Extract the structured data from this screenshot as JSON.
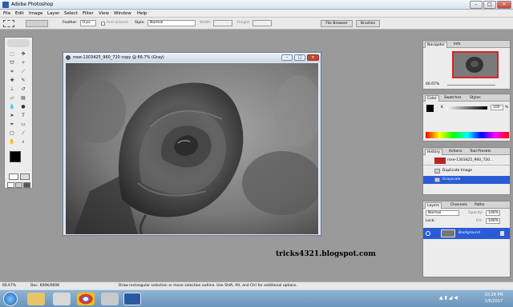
{
  "window": {
    "title": "Adobe Photoshop"
  },
  "menu": [
    "File",
    "Edit",
    "Image",
    "Layer",
    "Select",
    "Filter",
    "View",
    "Window",
    "Help"
  ],
  "options": {
    "feather_label": "Feather:",
    "feather_value": "0 px",
    "antialiased": "Anti-aliased",
    "style_label": "Style:",
    "style_value": "Normal",
    "width_label": "Width:",
    "height_label": "Height:",
    "tabs": [
      "File Browser",
      "Brushes"
    ]
  },
  "document": {
    "title": "rose-1303425_960_720 copy @ 66.7% (Gray)"
  },
  "navigator": {
    "tabs": [
      "Navigator",
      "Info"
    ],
    "zoom": "66.67%"
  },
  "color": {
    "tabs": [
      "Color",
      "Swatches",
      "Styles"
    ],
    "k_label": "K",
    "k_value": "100",
    "percent": "%"
  },
  "history": {
    "tabs": [
      "History",
      "Actions",
      "Tool Presets"
    ],
    "items": [
      "rose-1303425_960_720...",
      "Duplicate Image",
      "Grayscale"
    ]
  },
  "layers": {
    "tabs": [
      "Layers",
      "Channels",
      "Paths"
    ],
    "blend": "Normal",
    "opacity_label": "Opacity:",
    "opacity_value": "100%",
    "lock_label": "Lock:",
    "fill_label": "Fill:",
    "fill_value": "100%",
    "layer_name": "Background"
  },
  "watermark": "tricks4321.blogspot.com",
  "status": {
    "zoom": "66.67%",
    "doc": "Doc: 600K/600K",
    "hint": "Draw rectangular selection or move selection outline. Use Shift, Alt, and Ctrl for additional options."
  },
  "clock": {
    "time": "10:29 PM",
    "date": "2/6/2017"
  }
}
